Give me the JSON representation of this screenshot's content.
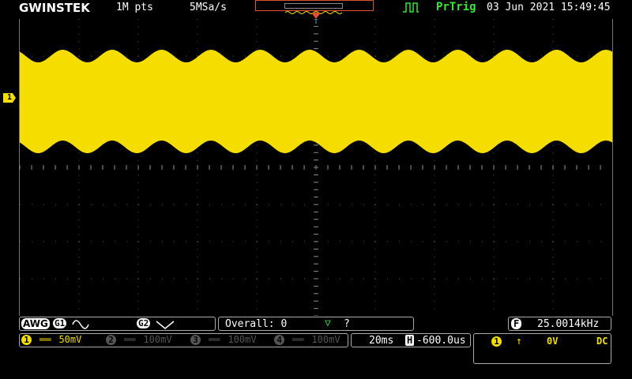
{
  "header": {
    "brand": "GWINSTEK",
    "memory_length": "1M pts",
    "sample_rate": "5MSa/s",
    "trigger_status": "PrTrig",
    "datetime": "03 Jun 2021 15:49:45"
  },
  "channel1_marker": "1",
  "awg": {
    "label": "AWG",
    "g1": "G1",
    "g1_wave": "sine-icon",
    "g2": "G2",
    "g2_wave": "triangle-icon"
  },
  "measurement": {
    "label": "Overall: 0",
    "value": "?"
  },
  "frequency": {
    "badge": "F",
    "value": "25.0014kHz"
  },
  "channels": [
    {
      "num": "1",
      "coupling": "══",
      "scale": "50mV",
      "active": true
    },
    {
      "num": "2",
      "coupling": "══",
      "scale": "100mV",
      "active": false
    },
    {
      "num": "3",
      "coupling": "══",
      "scale": "100mV",
      "active": false
    },
    {
      "num": "4",
      "coupling": "══",
      "scale": "100mV",
      "active": false
    }
  ],
  "timebase": {
    "scale": "20ms",
    "h_badge": "H",
    "position": "-600.0us"
  },
  "trigger": {
    "source": "1",
    "edge": "↑",
    "level": "0V",
    "coupling": "DC"
  },
  "colors": {
    "ch1": "#f5dd00",
    "trig_status": "#39e639",
    "marker": "#e0502a"
  }
}
